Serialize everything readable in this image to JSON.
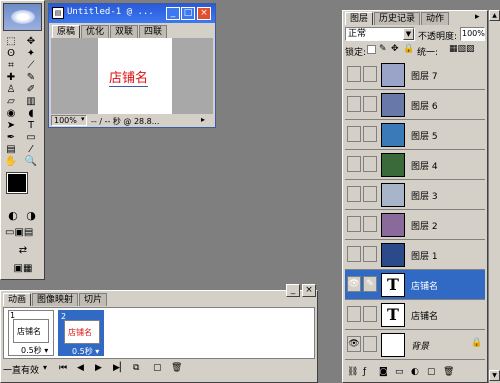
{
  "toolbox": {
    "tools": [
      {
        "name": "marquee-icon",
        "glyph": "⬚"
      },
      {
        "name": "move-icon",
        "glyph": "✥"
      },
      {
        "name": "lasso-icon",
        "glyph": "ʘ"
      },
      {
        "name": "magic-wand-icon",
        "glyph": "✦"
      },
      {
        "name": "crop-icon",
        "glyph": "⌗"
      },
      {
        "name": "slice-icon",
        "glyph": "⟋"
      },
      {
        "name": "healing-icon",
        "glyph": "✚"
      },
      {
        "name": "brush-icon",
        "glyph": "✎"
      },
      {
        "name": "stamp-icon",
        "glyph": "♙"
      },
      {
        "name": "history-brush-icon",
        "glyph": "✐"
      },
      {
        "name": "eraser-icon",
        "glyph": "▱"
      },
      {
        "name": "gradient-icon",
        "glyph": "▥"
      },
      {
        "name": "blur-icon",
        "glyph": "◉"
      },
      {
        "name": "dodge-icon",
        "glyph": "◖"
      },
      {
        "name": "path-select-icon",
        "glyph": "➤"
      },
      {
        "name": "type-icon",
        "glyph": "T"
      },
      {
        "name": "pen-icon",
        "glyph": "✒"
      },
      {
        "name": "shape-icon",
        "glyph": "▭"
      },
      {
        "name": "notes-icon",
        "glyph": "▤"
      },
      {
        "name": "eyedropper-icon",
        "glyph": "⁄"
      },
      {
        "name": "hand-icon",
        "glyph": "✋"
      },
      {
        "name": "zoom-icon",
        "glyph": "🔍"
      }
    ]
  },
  "document": {
    "title": "Untitled-1 @ ...",
    "tabs": [
      "原稿",
      "优化",
      "双联",
      "四联"
    ],
    "canvas_text": "店铺名",
    "zoom": "100%",
    "status": "-- / -- 秒 @ 28.8...",
    "accent_text_color": "#e01010"
  },
  "layers_panel": {
    "tabs": [
      "图层",
      "历史记录",
      "动作"
    ],
    "blend_mode": "正常",
    "opacity_label": "不透明度:",
    "opacity_value": "100%",
    "lock_label": "锁定:",
    "unify_label": "统一:",
    "layers": [
      {
        "name": "图层 7",
        "thumb": "#9aa4c8",
        "visible": false,
        "selected": false
      },
      {
        "name": "图层 6",
        "thumb": "#6878a8",
        "visible": false,
        "selected": false
      },
      {
        "name": "图层 5",
        "thumb": "#3a7ab8",
        "visible": false,
        "selected": false
      },
      {
        "name": "图层 4",
        "thumb": "#3b6a3a",
        "visible": false,
        "selected": false
      },
      {
        "name": "图层 3",
        "thumb": "#a8b4c8",
        "visible": false,
        "selected": false
      },
      {
        "name": "图层 2",
        "thumb": "#8a6a9a",
        "visible": false,
        "selected": false
      },
      {
        "name": "图层 1",
        "thumb": "#2a4a8a",
        "visible": false,
        "selected": false
      },
      {
        "name": "店铺名",
        "thumb": "T",
        "visible": true,
        "selected": true
      },
      {
        "name": "店铺名",
        "thumb": "T",
        "visible": false,
        "selected": false
      },
      {
        "name": "背景",
        "thumb": "#ffffff",
        "visible": true,
        "selected": false
      }
    ]
  },
  "animation_panel": {
    "tabs": [
      "动画",
      "图像映射",
      "切片"
    ],
    "frames": [
      {
        "number": "1",
        "text": "店铺名",
        "delay": "0.5秒",
        "text_color": "#000000"
      },
      {
        "number": "2",
        "text": "店铺名",
        "delay": "0.5秒",
        "text_color": "#e01010"
      }
    ],
    "loop": "一直有效"
  }
}
